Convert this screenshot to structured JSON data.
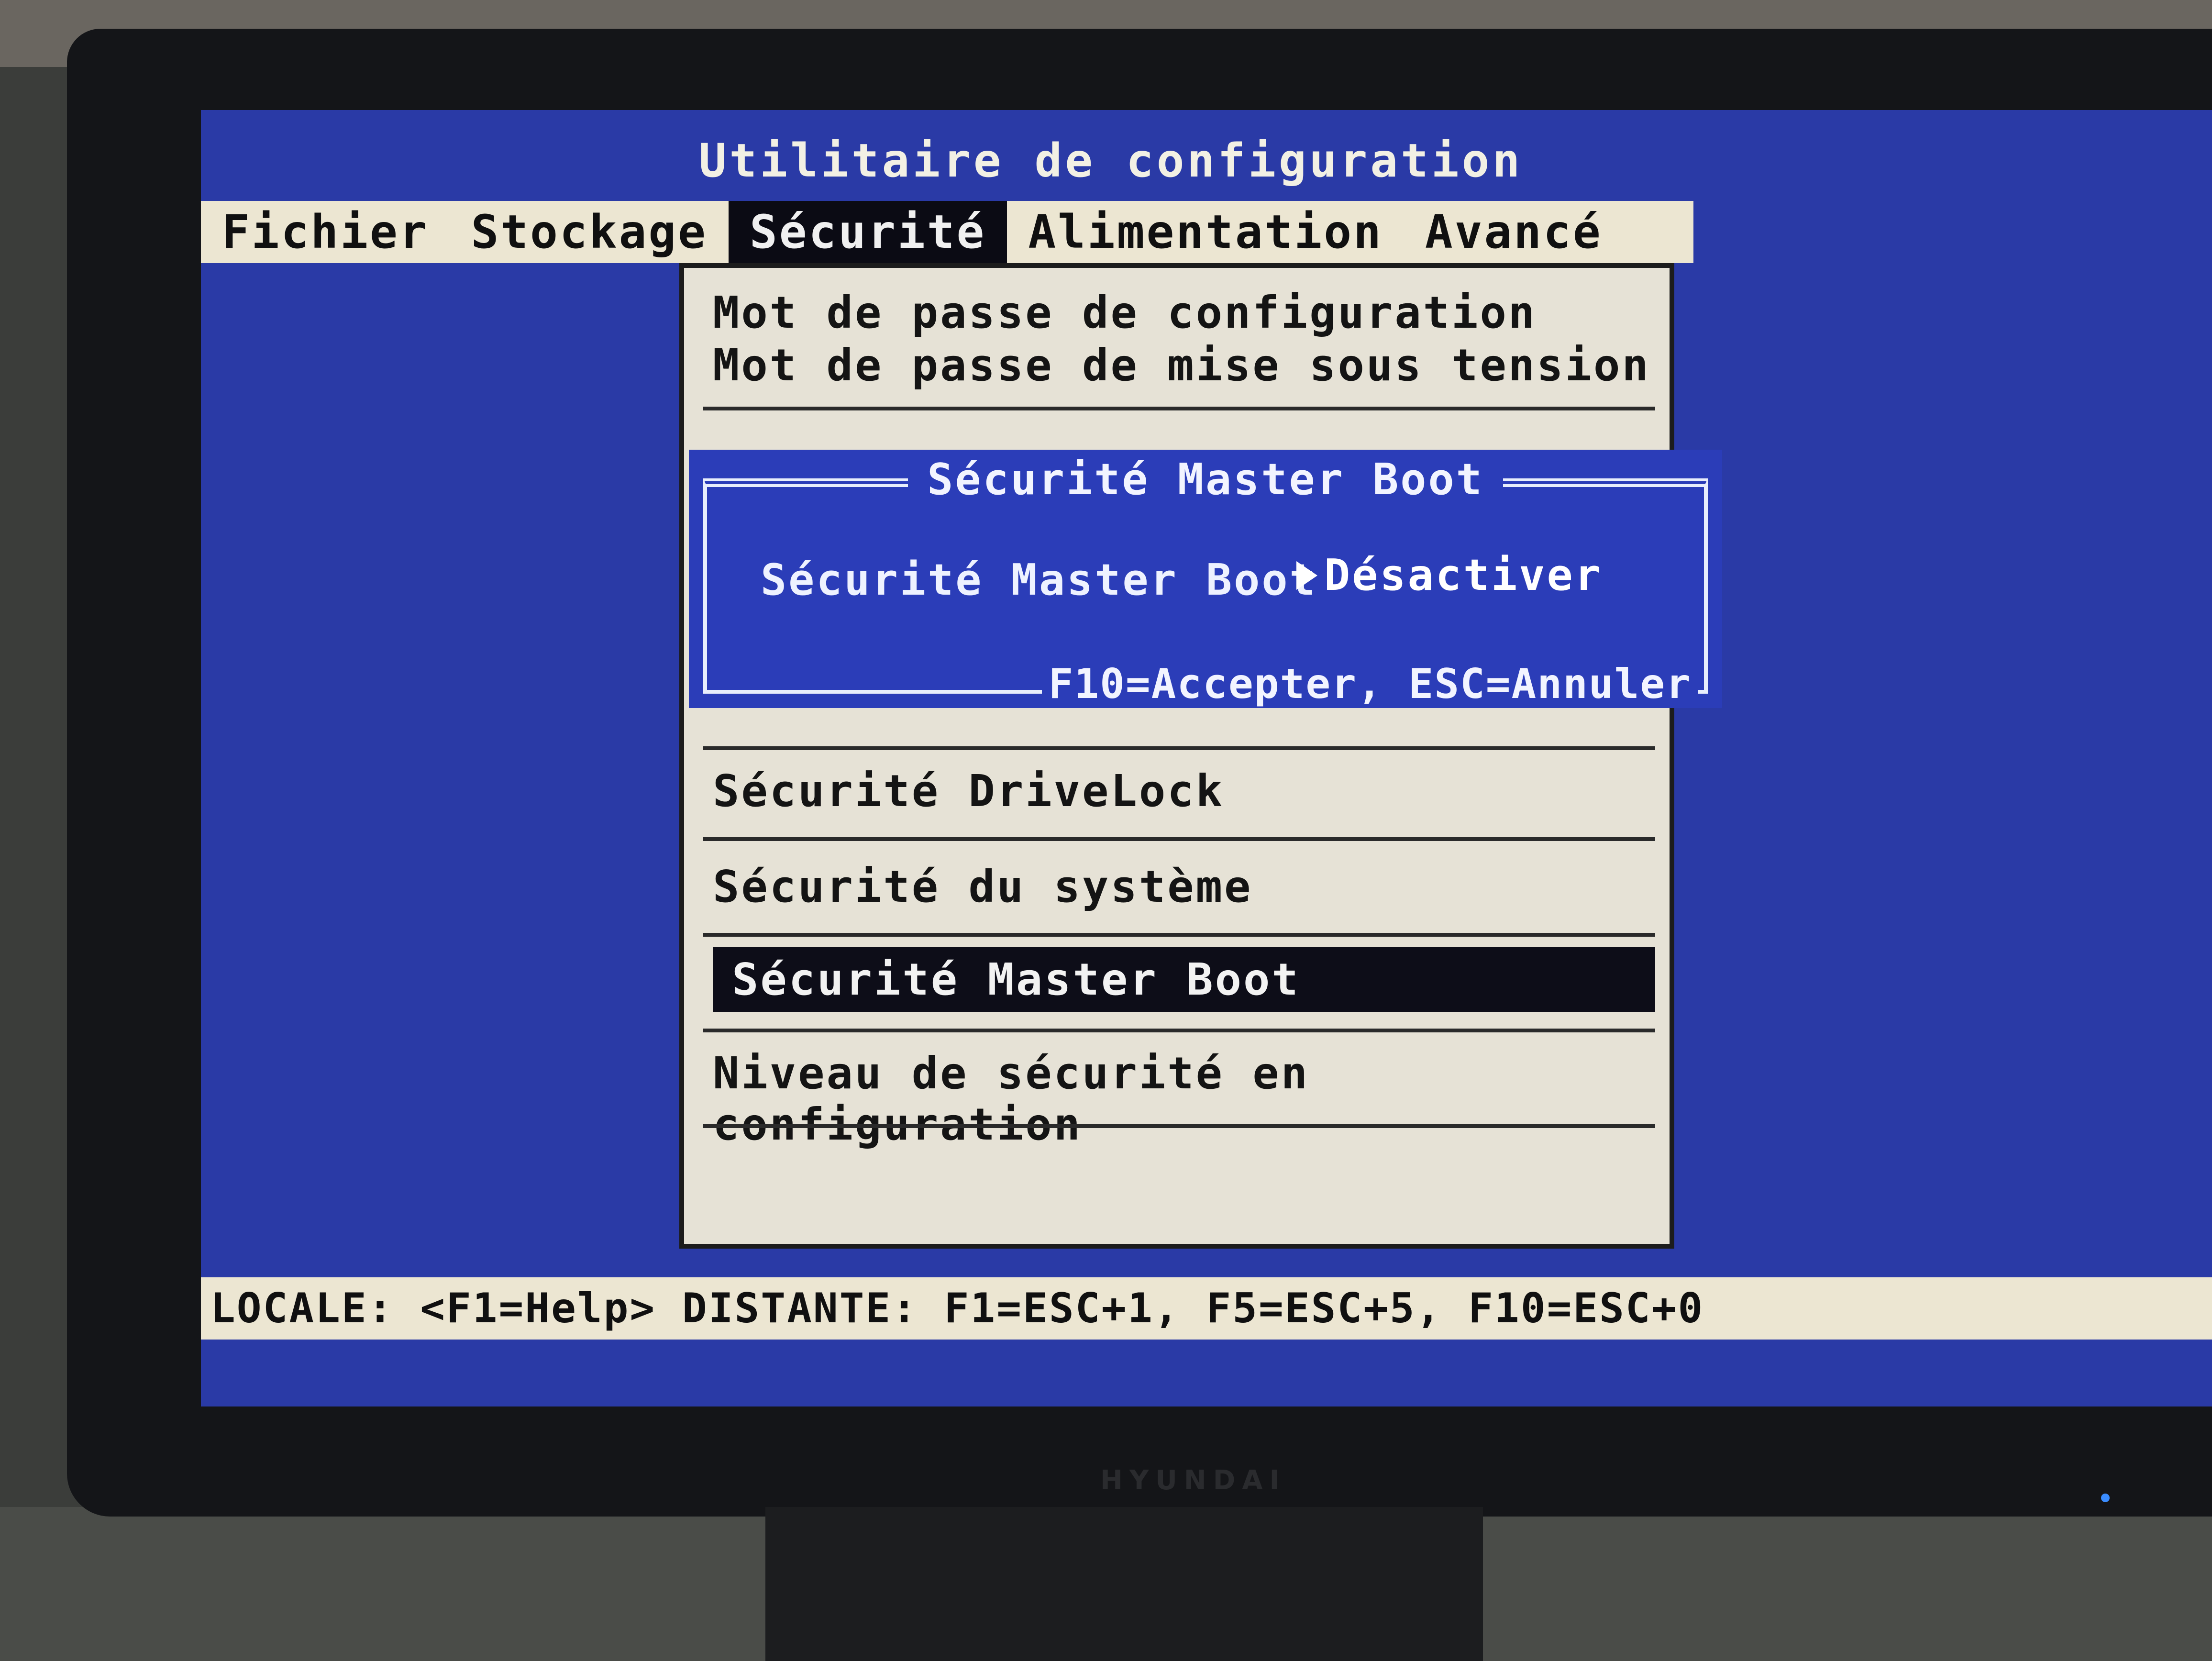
{
  "screen": {
    "title": "Utilitaire de configuration"
  },
  "menubar": {
    "items": [
      "Fichier",
      "Stockage",
      "Sécurité",
      "Alimentation",
      "Avancé"
    ],
    "active_index": 2
  },
  "dropdown": {
    "items": [
      "Mot de passe de configuration",
      "Mot de passe de mise sous tension",
      "Sécurité DriveLock",
      "Sécurité du système",
      "Sécurité Master Boot",
      "Niveau de sécurité en configuration"
    ],
    "selected_index": 4
  },
  "popup": {
    "title": "Sécurité Master Boot",
    "label": "Sécurité Master Boot",
    "value": "Désactiver",
    "footer": "F10=Accepter, ESC=Annuler"
  },
  "statusbar": {
    "text": "LOCALE: <F1=Help> DISTANTE: F1=ESC+1, F5=ESC+5, F10=ESC+0"
  },
  "monitor": {
    "brand": "HYUNDAI"
  },
  "colors": {
    "screen_bg": "#2a3aa6",
    "menu_bg": "#ece6d2",
    "highlight_bg": "#0b0b14",
    "popup_bg": "#2b3db8"
  }
}
